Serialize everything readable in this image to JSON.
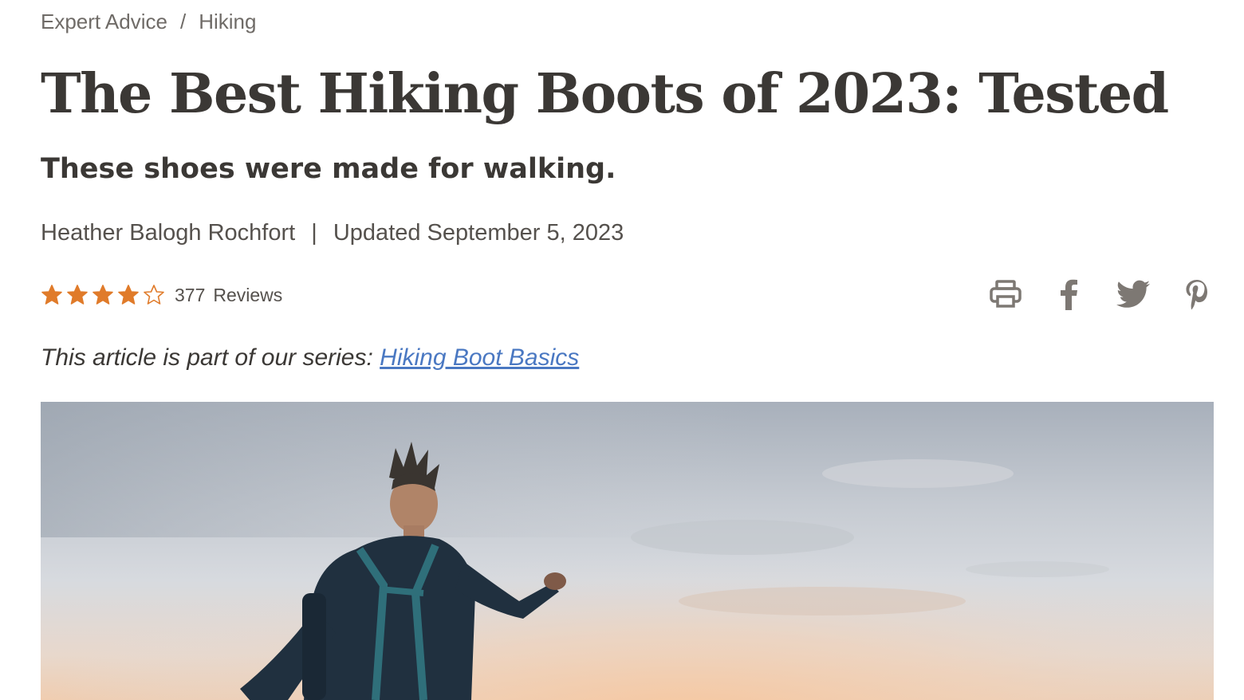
{
  "breadcrumb": {
    "items": [
      "Expert Advice",
      "Hiking"
    ],
    "separator": "/"
  },
  "article": {
    "title": "The Best Hiking Boots of 2023: Tested",
    "subtitle": "These shoes were made for walking.",
    "author": "Heather Balogh Rochfort",
    "byline_separator": "|",
    "updated": "Updated September 5, 2023"
  },
  "rating": {
    "stars_filled": 4,
    "stars_total": 5,
    "review_count": "377",
    "review_label": "Reviews",
    "star_color": "#e07b2a"
  },
  "share": {
    "icons": [
      "print-icon",
      "facebook-icon",
      "twitter-icon",
      "pinterest-icon"
    ],
    "icon_color": "#7d7873"
  },
  "series": {
    "prefix": "This article is part of our series:",
    "link_label": "Hiking Boot Basics",
    "link_color": "#4a78c2"
  },
  "hero_image": {
    "subject": "hiker with backpack against sunset sky"
  }
}
